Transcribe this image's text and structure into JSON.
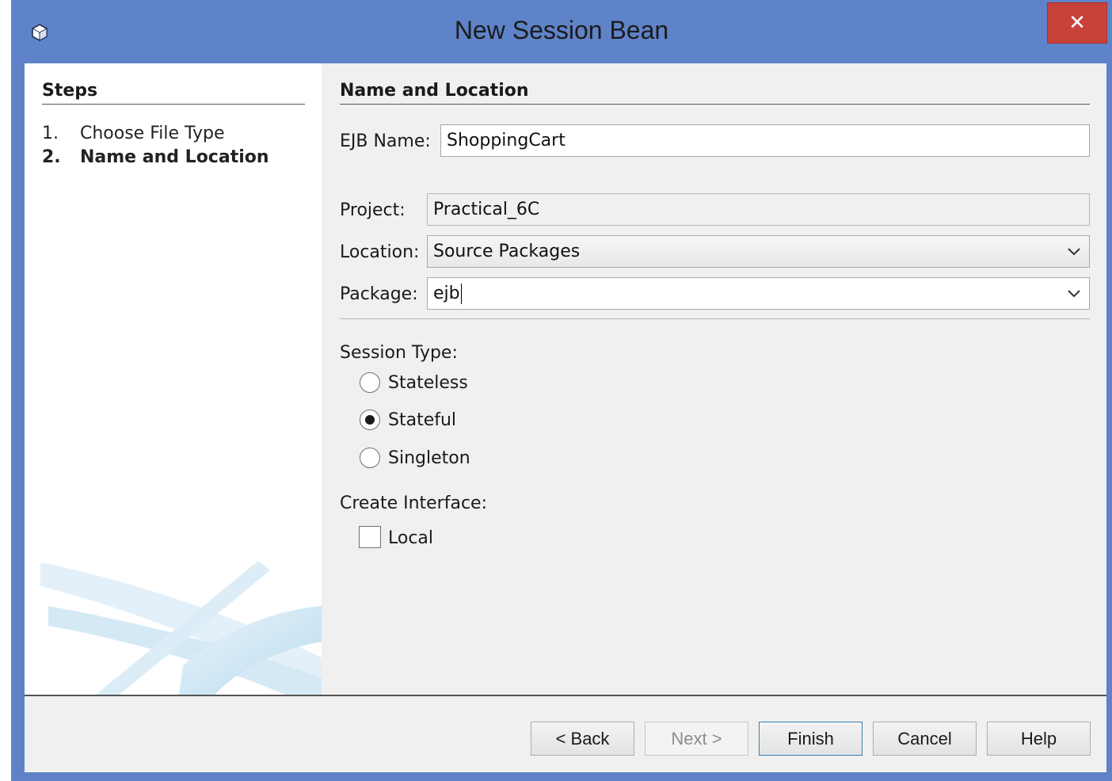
{
  "window": {
    "title": "New Session Bean",
    "close_label": "✕",
    "colors": {
      "titlebar": "#5f83c8",
      "close": "#c7423a"
    }
  },
  "steps": {
    "heading": "Steps",
    "items": [
      {
        "num": "1.",
        "label": "Choose File Type",
        "current": false
      },
      {
        "num": "2.",
        "label": "Name and Location",
        "current": true
      }
    ]
  },
  "form": {
    "heading": "Name and Location",
    "ejb_name": {
      "label": "EJB Name:",
      "value": "ShoppingCart"
    },
    "project": {
      "label": "Project:",
      "value": "Practical_6C"
    },
    "location": {
      "label": "Location:",
      "value": "Source Packages"
    },
    "package": {
      "label": "Package:",
      "value": "ejb"
    },
    "session_type": {
      "label": "Session Type:",
      "options": [
        {
          "label": "Stateless",
          "selected": false
        },
        {
          "label": "Stateful",
          "selected": true
        },
        {
          "label": "Singleton",
          "selected": false
        }
      ]
    },
    "create_interface": {
      "label": "Create Interface:",
      "options": [
        {
          "label": "Local",
          "checked": false
        }
      ]
    }
  },
  "buttons": {
    "back": "< Back",
    "next": "Next >",
    "finish": "Finish",
    "cancel": "Cancel",
    "help": "Help"
  }
}
